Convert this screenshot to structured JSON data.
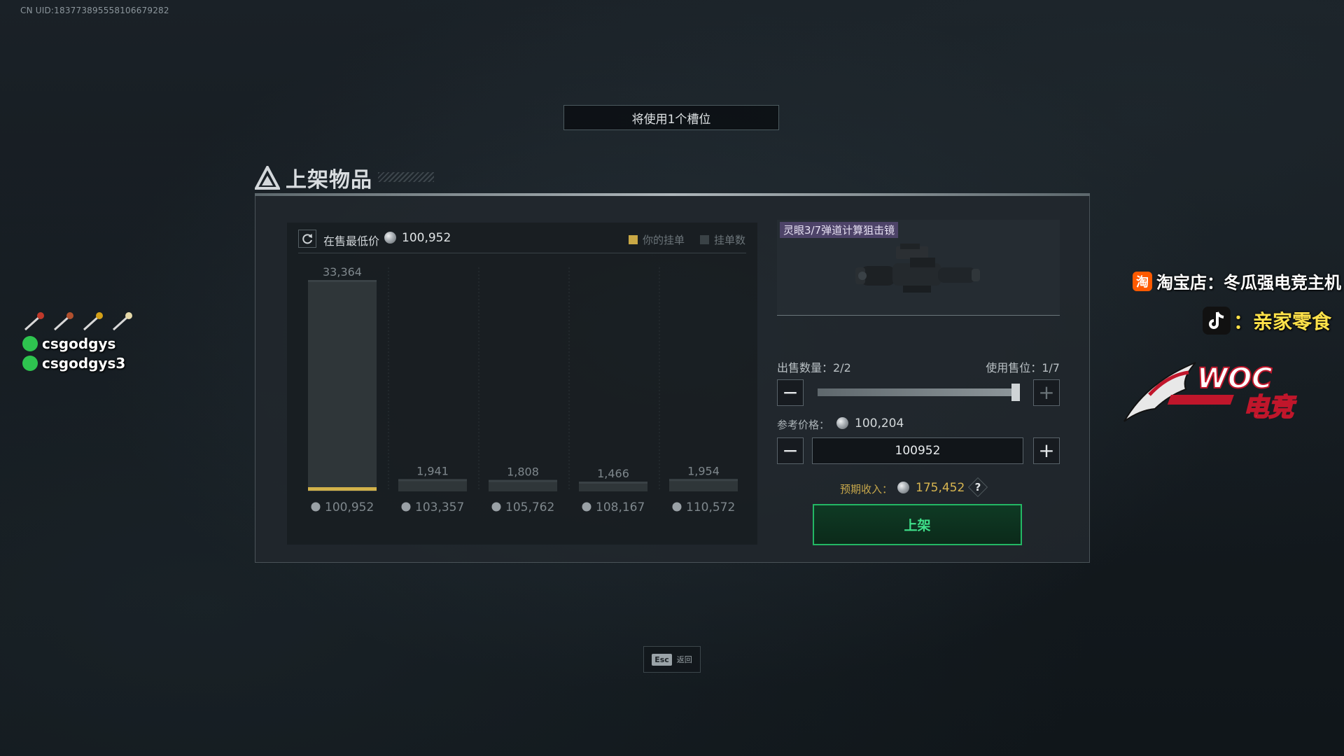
{
  "uid": "CN UID:183773895558106679282",
  "slot_banner": "将使用1个槽位",
  "page_title": "上架物品",
  "chart_header": {
    "lowest_label": "在售最低价",
    "lowest_value": "100,952",
    "legend_yours": "你的挂单",
    "legend_count": "挂单数"
  },
  "chart_data": {
    "type": "bar",
    "categories": [
      "100,952",
      "103,357",
      "105,762",
      "108,167",
      "110,572"
    ],
    "series": [
      {
        "name": "挂单数",
        "values": [
          33364,
          1941,
          1808,
          1466,
          1954
        ]
      },
      {
        "name": "你的挂单",
        "values": [
          2,
          0,
          0,
          0,
          0
        ]
      }
    ],
    "value_labels": [
      "33,364",
      "1,941",
      "1,808",
      "1,466",
      "1,954"
    ],
    "ylim": [
      0,
      33364
    ],
    "colors": {
      "count": "#2f3639",
      "count_top": "#3a4246",
      "yours": "#d2b24a"
    }
  },
  "item": {
    "name": "灵眼3/7弹道计算狙击镜"
  },
  "form": {
    "qty_label": "出售数量：2/2",
    "slot_label": "使用售位：1/7",
    "qty_fraction": 1.0,
    "ref_label": "参考价格：",
    "ref_value": "100,204",
    "price_value": "100952",
    "income_label": "预期收入：",
    "income_value": "175,452",
    "help": "?",
    "list_button": "上架",
    "minus": "−",
    "plus": "+"
  },
  "esc_hint": {
    "key": "Esc",
    "label": "返回"
  },
  "overlay": {
    "chat_lines": [
      "csgodgys",
      "csgodgys3"
    ],
    "taobao_badge": "淘",
    "taobao_text": "淘宝店：冬瓜强电竞主机",
    "douyin_text": "：亲家零食",
    "woc_brand": "WOC",
    "woc_sub": "电竞"
  },
  "colors": {
    "accent_green": "#23b764",
    "accent_gold": "#d2b24a",
    "item_tag": "#705896"
  }
}
